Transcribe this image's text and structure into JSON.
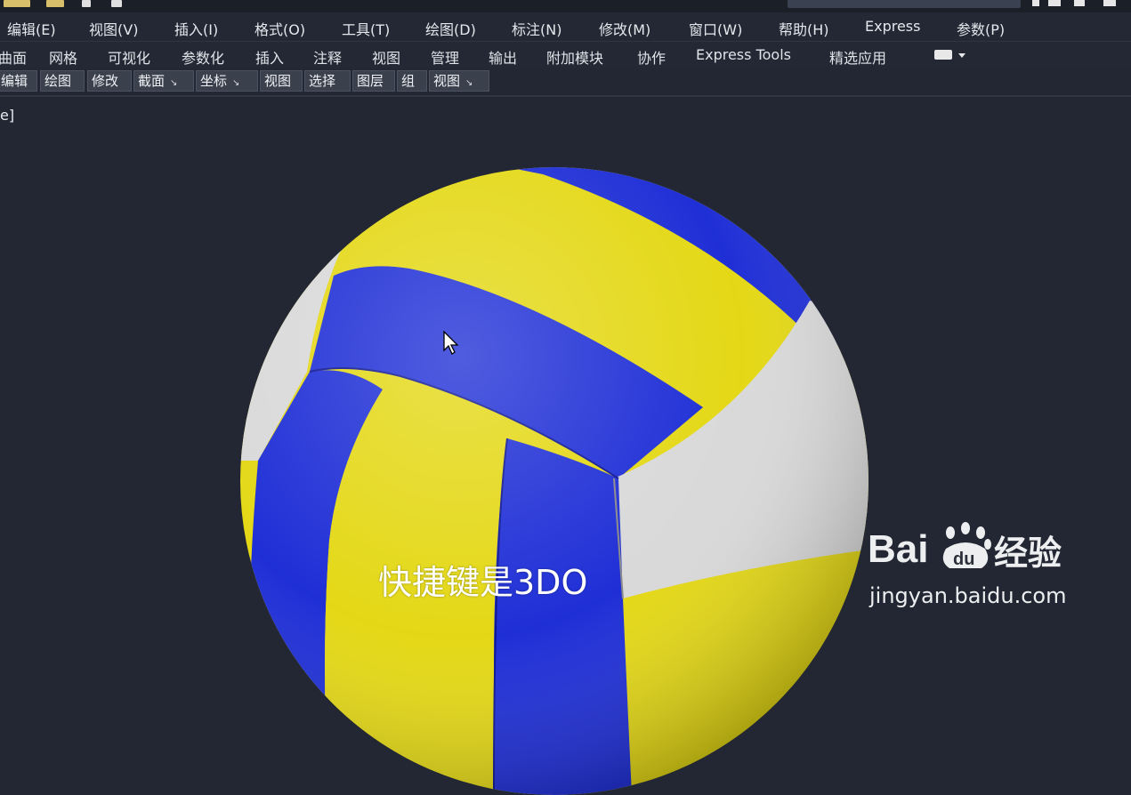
{
  "menubar": {
    "items": [
      "编辑(E)",
      "视图(V)",
      "插入(I)",
      "格式(O)",
      "工具(T)",
      "绘图(D)",
      "标注(N)",
      "修改(M)",
      "窗口(W)",
      "帮助(H)",
      "Express",
      "参数(P)"
    ]
  },
  "ribbon": {
    "tabs": [
      "曲面",
      "网格",
      "可视化",
      "参数化",
      "插入",
      "注释",
      "视图",
      "管理",
      "输出",
      "附加模块",
      "协作",
      "Express Tools",
      "精选应用"
    ]
  },
  "panels": {
    "items": [
      "编辑",
      "绘图",
      "修改",
      "截面",
      "坐标",
      "视图",
      "选择",
      "图层",
      "组",
      "视图"
    ]
  },
  "viewport": {
    "label": "e]"
  },
  "overlay": {
    "subtitle": "快捷键是3DO",
    "watermark_text": "经验",
    "watermark_brand": "Bai du",
    "watermark_url": "jingyan.baidu.com"
  },
  "colors": {
    "background": "#222733",
    "ball_yellow": "#e4d816",
    "ball_blue": "#1f2fd6",
    "ball_white": "#d9d9d9"
  }
}
